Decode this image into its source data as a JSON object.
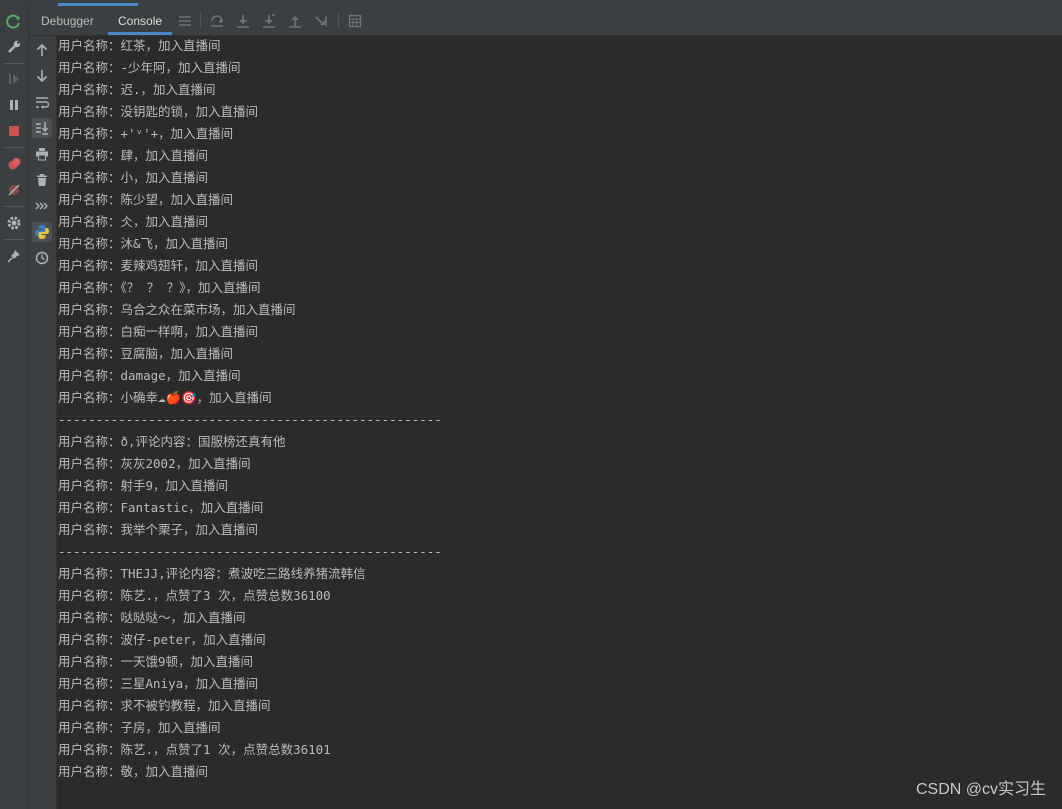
{
  "tabs": [
    {
      "label": "Debugger"
    },
    {
      "label": "Console"
    }
  ],
  "toolbar": {
    "icons": [
      "lines-icon",
      "step-over-icon",
      "step-into-icon",
      "force-step-into-icon",
      "step-out-icon",
      "run-to-cursor-icon",
      "evaluate-icon"
    ]
  },
  "outer_toolbar": {
    "icons": [
      "rerun-icon",
      "settings-wrench-icon",
      "resume-icon",
      "pause-icon",
      "stop-icon",
      "view-breakpoints-icon",
      "mute-breakpoints-icon",
      "gear-icon",
      "pin-icon"
    ]
  },
  "side_toolbar": {
    "icons": [
      "up-arrow-icon",
      "down-arrow-icon",
      "soft-wrap-icon",
      "scroll-to-end-icon",
      "print-icon",
      "trash-icon",
      "show-command-icon",
      "python-console-icon",
      "history-icon"
    ]
  },
  "console": {
    "lines": [
      "用户名称：红茶，加入直播间",
      "用户名称：-少年阿，加入直播间",
      "用户名称：迟.，加入直播间",
      "用户名称：没钥匙的锁，加入直播间",
      "用户名称：+'ᵛ'+，加入直播间",
      "用户名称：肆，加入直播间",
      "用户名称：小，加入直播间",
      "用户名称：陈少望，加入直播间",
      "用户名称：仌，加入直播间",
      "用户名称：沐&飞，加入直播间",
      "用户名称：麦辣鸡翅轩，加入直播间",
      "用户名称：《？ ？ ？》，加入直播间",
      "用户名称：乌合之众在菜市场，加入直播间",
      "用户名称：白痴一样啊，加入直播间",
      "用户名称：豆腐脑，加入直播间",
      "用户名称：damage，加入直播间",
      "用户名称：小确幸☁🍎🎯，加入直播间",
      "---------------------------------------------------",
      "用户名称：ð,评论内容：国服榜还真有他",
      "用户名称：灰灰2002，加入直播间",
      "用户名称：射手9，加入直播间",
      "用户名称：Fantastic，加入直播间",
      "用户名称：我举个栗子，加入直播间",
      "---------------------------------------------------",
      "用户名称：THEJJ,评论内容：煮波吃三路线养猪流韩信",
      "用户名称：陈艺.，点赞了3 次，点赞总数36100",
      "用户名称：哒哒哒～，加入直播间",
      "用户名称：波仔-peter，加入直播间",
      "用户名称：一天饿9顿，加入直播间",
      "用户名称：三星Aniya，加入直播间",
      "用户名称：求不被钓教程，加入直播间",
      "用户名称：子房，加入直播间",
      "用户名称：陈艺.，点赞了1 次，点赞总数36101",
      "用户名称：敬，加入直播间"
    ]
  },
  "watermark": "CSDN @cv实习生",
  "colors": {
    "background": "#2b2b2b",
    "panel": "#3c3f41",
    "text": "#bbbbbb",
    "accent": "#4a88c7"
  }
}
